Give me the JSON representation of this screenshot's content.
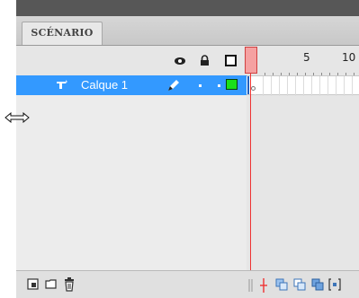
{
  "panel": {
    "tab_label": "SCÉNARIO"
  },
  "header": {
    "icons": [
      "eye-icon",
      "lock-icon",
      "outline-icon"
    ]
  },
  "ruler": {
    "labels": [
      "5",
      "10"
    ]
  },
  "layers": [
    {
      "name": "Calque 1",
      "selected": true,
      "outline_color": "#1adf1a"
    }
  ],
  "colors": {
    "selection": "#3399ff",
    "playhead": "#e33333",
    "top_bar": "#575757"
  }
}
